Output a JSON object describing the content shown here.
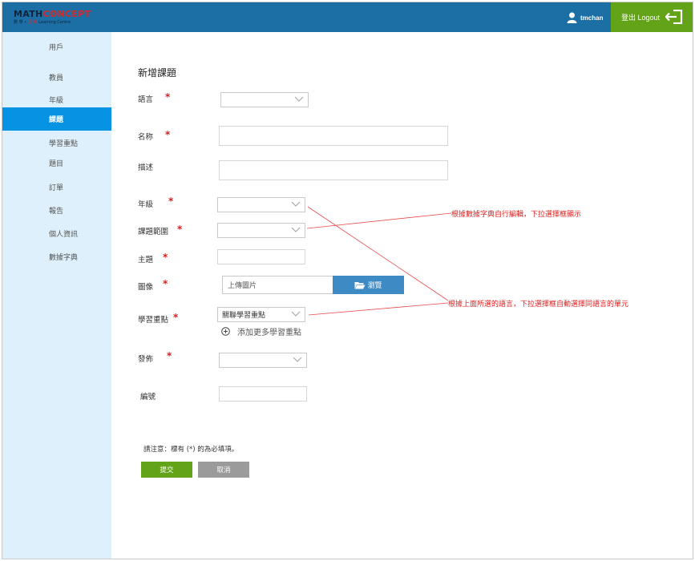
{
  "brand": {
    "logo_main_1": "MATH",
    "logo_main_2": "CONCEPT",
    "logo_sub_1": "數 學 ∙ ",
    "logo_sub_2": "思 維",
    "logo_sub_3": " Learning Centre"
  },
  "header": {
    "username": "tmchan",
    "logout_label": "登出 Logout"
  },
  "sidebar": {
    "items": [
      {
        "label": "用戶",
        "active": false
      },
      {
        "label": "教員",
        "active": false
      },
      {
        "label": "年級",
        "active": false
      },
      {
        "label": "課題",
        "active": true
      },
      {
        "label": "學習重點",
        "active": false
      },
      {
        "label": "題目",
        "active": false
      },
      {
        "label": "訂單",
        "active": false
      },
      {
        "label": "報告",
        "active": false
      },
      {
        "label": "個人資訊",
        "active": false
      },
      {
        "label": "數據字典",
        "active": false
      }
    ]
  },
  "form": {
    "title": "新增課題",
    "language_label": "語言",
    "name_label": "名称",
    "description_label": "描述",
    "grade_label": "年級",
    "scope_label": "課題範圍",
    "subject_label": "主題",
    "image_label": "圖像",
    "upload_placeholder": "上傳圖片",
    "browse_label": "瀏覽",
    "key_point_label": "學習重點",
    "key_point_value": "關聯學習重點",
    "add_more_label": "添加更多學習重點",
    "publish_label": "發佈",
    "number_label": "編號",
    "required_mark": "*",
    "note": "請注意：標有 (*) 的為必填項。",
    "submit_label": "提交",
    "cancel_label": "取消"
  },
  "annotations": {
    "dictionary_note": "根據數據字典自行編輯，下拉選擇框顯示",
    "language_note": "根據上面所選的語言，下拉選擇框自動選擇同語言的單元"
  },
  "colors": {
    "header_bg": "#1b6fa5",
    "logout_bg": "#63a317",
    "sidebar_bg": "#def0fb",
    "active_item": "#0693e3",
    "required": "#d31f1f",
    "browse_bg": "#3d8ac4",
    "submit_bg": "#63a317",
    "cancel_bg": "#9b9b9b",
    "annotation": "#e02020"
  }
}
